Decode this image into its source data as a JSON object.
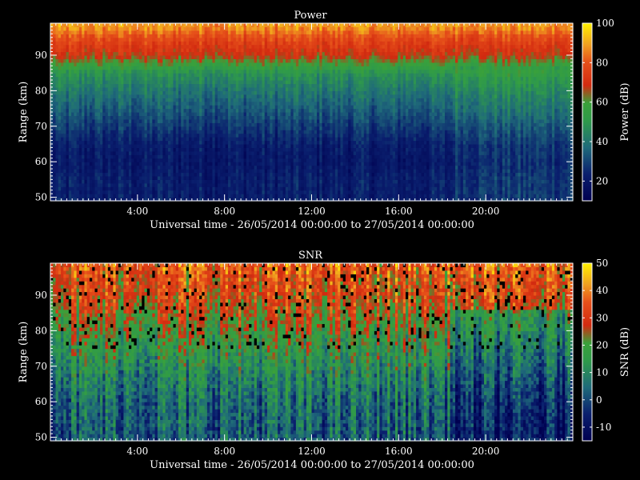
{
  "chart_data": [
    {
      "type": "heatmap",
      "title": "Power",
      "xlabel": "Universal time - 26/05/2014 00:00:00 to 27/05/2014 00:00:00",
      "ylabel": "Range (km)",
      "colorbar_label": "Power (dB)",
      "x_ticks": [
        "4:00",
        "8:00",
        "12:00",
        "16:00",
        "20:00"
      ],
      "x_tick_hours": [
        4,
        8,
        12,
        16,
        20
      ],
      "xlim_hours": [
        0,
        24
      ],
      "y_ticks": [
        50,
        60,
        70,
        80,
        90
      ],
      "ylim": [
        49,
        99
      ],
      "colorbar_ticks": [
        20,
        40,
        60,
        80,
        100
      ],
      "colorbar_range": [
        10,
        100
      ],
      "colormap": "blue-green-red-yellow",
      "value_profile": {
        "description": "approximate typical power (dB) vs range",
        "range_km": [
          50,
          55,
          60,
          65,
          70,
          75,
          80,
          85,
          88,
          90,
          95,
          98
        ],
        "value_db": [
          22,
          22,
          20,
          22,
          28,
          34,
          40,
          48,
          60,
          68,
          78,
          88
        ]
      }
    },
    {
      "type": "heatmap",
      "title": "SNR",
      "xlabel": "Universal time - 26/05/2014 00:00:00 to 27/05/2014 00:00:00",
      "ylabel": "Range (km)",
      "colorbar_label": "SNR (dB)",
      "x_ticks": [
        "4:00",
        "8:00",
        "12:00",
        "16:00",
        "20:00"
      ],
      "x_tick_hours": [
        4,
        8,
        12,
        16,
        20
      ],
      "xlim_hours": [
        0,
        24
      ],
      "y_ticks": [
        50,
        60,
        70,
        80,
        90
      ],
      "ylim": [
        49,
        99
      ],
      "colorbar_ticks": [
        -10,
        0,
        10,
        20,
        30,
        40,
        50
      ],
      "colorbar_range": [
        -15,
        50
      ],
      "colormap": "blue-green-red-yellow",
      "value_profile": {
        "description": "approximate typical SNR (dB) vs range",
        "range_km": [
          50,
          55,
          60,
          65,
          70,
          75,
          80,
          85,
          88,
          90,
          95,
          98
        ],
        "value_db": [
          2,
          3,
          5,
          8,
          12,
          16,
          20,
          25,
          28,
          30,
          32,
          35
        ]
      }
    }
  ]
}
